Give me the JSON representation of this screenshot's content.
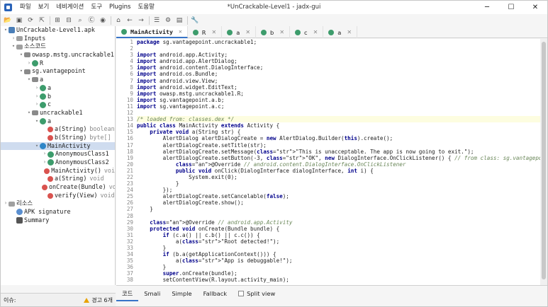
{
  "window": {
    "title": "*UnCrackable-Level1 - jadx-gui",
    "menu": [
      "파일",
      "보기",
      "네비게이션",
      "도구",
      "Plugins",
      "도움말"
    ]
  },
  "toolbar": {
    "icons": [
      "open-icon",
      "save-all-icon",
      "sync-icon",
      "export-icon",
      "expand-icon",
      "collapse-icon",
      "search-icon",
      "find-class-icon",
      "find-usage-icon",
      "home-icon",
      "back-icon",
      "forward-icon",
      "log-icon",
      "settings-icon",
      "deobfuscate-icon",
      "wrench-icon"
    ]
  },
  "tree": {
    "rows": [
      {
        "indent": 0,
        "arrow": "▾",
        "icon": "apk",
        "label": "UnCrackable-Level1.apk",
        "type": ""
      },
      {
        "indent": 1,
        "arrow": "›",
        "icon": "folder",
        "label": "Inputs",
        "type": ""
      },
      {
        "indent": 1,
        "arrow": "▾",
        "icon": "folder",
        "label": "소스코드",
        "type": ""
      },
      {
        "indent": 2,
        "arrow": "▾",
        "icon": "pkg",
        "label": "owasp.mstg.uncrackable1",
        "type": ""
      },
      {
        "indent": 3,
        "arrow": "›",
        "icon": "cls",
        "label": "R",
        "type": ""
      },
      {
        "indent": 2,
        "arrow": "▾",
        "icon": "pkg",
        "label": "sg.vantagepoint",
        "type": ""
      },
      {
        "indent": 3,
        "arrow": "▾",
        "icon": "pkg",
        "label": "a",
        "type": ""
      },
      {
        "indent": 4,
        "arrow": "›",
        "icon": "cls",
        "label": "a",
        "type": ""
      },
      {
        "indent": 4,
        "arrow": "›",
        "icon": "cls",
        "label": "b",
        "type": ""
      },
      {
        "indent": 4,
        "arrow": "›",
        "icon": "cls",
        "label": "c",
        "type": ""
      },
      {
        "indent": 3,
        "arrow": "▾",
        "icon": "pkg",
        "label": "uncrackable1",
        "type": ""
      },
      {
        "indent": 4,
        "arrow": "▾",
        "icon": "cls",
        "label": "a",
        "type": ""
      },
      {
        "indent": 5,
        "arrow": "",
        "icon": "m",
        "label": "a(String)",
        "type": "boolean"
      },
      {
        "indent": 5,
        "arrow": "",
        "icon": "m",
        "label": "b(String)",
        "type": "byte[]"
      },
      {
        "indent": 4,
        "arrow": "▾",
        "icon": "clsb",
        "label": "MainActivity",
        "type": "",
        "selected": true
      },
      {
        "indent": 5,
        "arrow": "›",
        "icon": "cls",
        "label": "AnonymousClass1",
        "type": ""
      },
      {
        "indent": 5,
        "arrow": "›",
        "icon": "cls",
        "label": "AnonymousClass2",
        "type": ""
      },
      {
        "indent": 5,
        "arrow": "",
        "icon": "m",
        "label": "MainActivity()",
        "type": "voi"
      },
      {
        "indent": 5,
        "arrow": "",
        "icon": "m",
        "label": "a(String)",
        "type": "void"
      },
      {
        "indent": 5,
        "arrow": "",
        "icon": "m",
        "label": "onCreate(Bundle)",
        "type": "vo"
      },
      {
        "indent": 5,
        "arrow": "",
        "icon": "m",
        "label": "verify(View)",
        "type": "void"
      },
      {
        "indent": 0,
        "arrow": "›",
        "icon": "folder",
        "label": "리소스",
        "type": ""
      },
      {
        "indent": 1,
        "arrow": "",
        "icon": "sig",
        "label": "APK signature",
        "type": ""
      },
      {
        "indent": 1,
        "arrow": "",
        "icon": "sum",
        "label": "Summary",
        "type": ""
      }
    ]
  },
  "tabs": [
    {
      "label": "MainActivity",
      "active": true
    },
    {
      "label": "R",
      "active": false
    },
    {
      "label": "a",
      "active": false
    },
    {
      "label": "b",
      "active": false
    },
    {
      "label": "c",
      "active": false
    },
    {
      "label": "a",
      "active": false
    }
  ],
  "code": {
    "first_line": 1,
    "lines": [
      "package sg.vantagepoint.uncrackable1;",
      "",
      "import android.app.Activity;",
      "import android.app.AlertDialog;",
      "import android.content.DialogInterface;",
      "import android.os.Bundle;",
      "import android.view.View;",
      "import android.widget.EditText;",
      "import owasp.mstg.uncrackable1.R;",
      "import sg.vantagepoint.a.b;",
      "import sg.vantagepoint.a.c;",
      "",
      "/* loaded from: classes.dex */",
      "public class MainActivity extends Activity {",
      "    private void a(String str) {",
      "        AlertDialog alertDialogCreate = new AlertDialog.Builder(this).create();",
      "        alertDialogCreate.setTitle(str);",
      "        alertDialogCreate.setMessage(\"This is unacceptable. The app is now going to exit.\");",
      "        alertDialogCreate.setButton(-3, \"OK\", new DialogInterface.OnClickListener() { // from class: sg.vantagepoint.uncrac",
      "            @Override // android.content.DialogInterface.OnClickListener",
      "            public void onClick(DialogInterface dialogInterface, int i) {",
      "                System.exit(0);",
      "            }",
      "        });",
      "        alertDialogCreate.setCancelable(false);",
      "        alertDialogCreate.show();",
      "    }",
      "",
      "    @Override // android.app.Activity",
      "    protected void onCreate(Bundle bundle) {",
      "        if (c.a() || c.b() || c.c()) {",
      "            a(\"Root detected!\");",
      "        }",
      "        if (b.a(getApplicationContext())) {",
      "            a(\"App is debuggable!\");",
      "        }",
      "        super.onCreate(bundle);",
      "        setContentView(R.layout.activity_main);"
    ],
    "highlight_line": 13
  },
  "bottom_tabs": [
    "코드",
    "Smali",
    "Simple",
    "Fallback"
  ],
  "split_view_label": "Split view",
  "status": {
    "left": "이슈:",
    "warnings": "경고 6개"
  },
  "colors": {
    "accent": "#3874c8",
    "selection": "#cfdcef",
    "keyword": "#00008b",
    "string": "#207020",
    "comment": "#6a8759"
  }
}
